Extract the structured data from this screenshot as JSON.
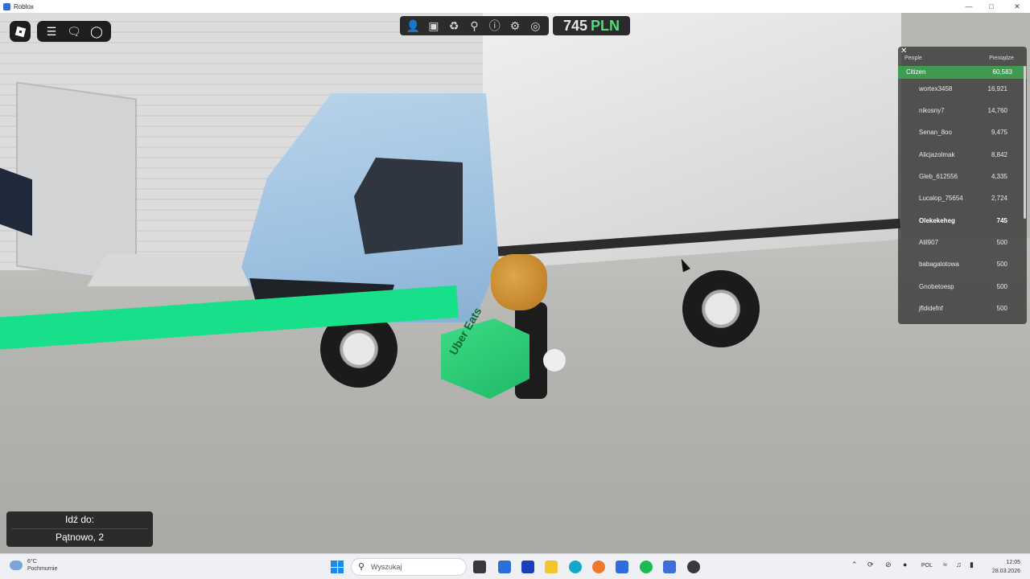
{
  "window": {
    "title": "Roblox"
  },
  "hud": {
    "menu_icon": "roblox-logo-icon",
    "icons": [
      "hamburger-icon",
      "chat-icon",
      "headset-icon"
    ]
  },
  "toolbar": {
    "icons": [
      "person-icon",
      "backpack-icon",
      "trophy-icon",
      "map-pin-icon",
      "info-icon",
      "gear-icon",
      "badge-icon"
    ],
    "money_amount": "745",
    "money_currency": "PLN",
    "money_color": "#4be07a"
  },
  "leaderboard": {
    "header_left": "People",
    "header_right": "Pieniądze",
    "team_name": "Citizen",
    "team_value": "60,583",
    "team_color": "#3f9b52",
    "rows": [
      {
        "name": "wortex3458",
        "value": "16,921"
      },
      {
        "name": "nikosny7",
        "value": "14,760"
      },
      {
        "name": "Senan_8oo",
        "value": "9,475"
      },
      {
        "name": "Alicjazolmak",
        "value": "8,842"
      },
      {
        "name": "Gleb_612556",
        "value": "4,335"
      },
      {
        "name": "Lucalop_75654",
        "value": "2,724"
      },
      {
        "name": "Olekekeheg",
        "value": "745"
      },
      {
        "name": "Alil907",
        "value": "500"
      },
      {
        "name": "babagalotowa",
        "value": "500"
      },
      {
        "name": "Gnobetoesp",
        "value": "500"
      },
      {
        "name": "jfldidefnf",
        "value": "500"
      }
    ]
  },
  "scene": {
    "bag_text": "Uber Eats",
    "path_color": "#18e08a"
  },
  "destination": {
    "label": "Idź do:",
    "value": "Pątnowo, 2"
  },
  "taskbar": {
    "weather_temp": "6°C",
    "weather_desc": "Pochmurnie",
    "search_placeholder": "Wyszukaj",
    "language": "POL",
    "time": "12:05",
    "date": "28.03.2026"
  }
}
